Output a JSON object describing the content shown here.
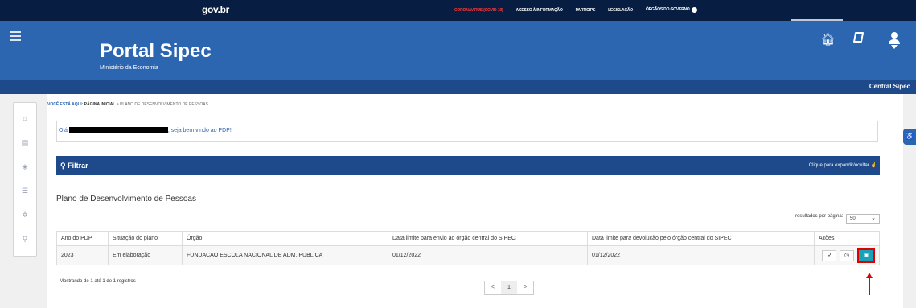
{
  "govbar": {
    "logo": "gov.br",
    "links": [
      "CORONAVÍRUS (COVID-19)",
      "ACESSO À INFORMAÇÃO",
      "PARTICIPE",
      "LEGISLAÇÃO",
      "ÓRGÃOS DO GOVERNO"
    ]
  },
  "header": {
    "title": "Portal Sipec",
    "subtitle": "Ministério da Economia",
    "subbar": "Central Sipec"
  },
  "breadcrumb": {
    "label": "VOCÊ ESTÁ AQUI:",
    "home": "PÁGINA INICIAL",
    "sep": ">",
    "current": "PLANO DE DESENVOLVIMENTO DE PESSOAS"
  },
  "welcome": {
    "prefix": "Olá",
    "suffix": ", seja bem vindo ao PDP!"
  },
  "filter": {
    "title": "Filtrar",
    "toggle": "Clique para expandir/ocultar"
  },
  "section_title": "Plano de Desenvolvimento de Pessoas",
  "per_page": {
    "label": "resultados por página:",
    "value": "50"
  },
  "table": {
    "headers": [
      "Ano do PDP",
      "Situação do plano",
      "Órgão",
      "Data limite para envio ao órgão central do SIPEC",
      "Data limite para devolução pelo órgão central do SIPEC",
      "Ações"
    ],
    "rows": [
      [
        "2023",
        "Em elaboração",
        "FUNDACAO ESCOLA NACIONAL DE ADM. PUBLICA",
        "01/12/2022",
        "01/12/2022"
      ]
    ]
  },
  "records": "Mostrando de 1 até 1 de 1 registros",
  "pager": {
    "prev": "<",
    "page": "1",
    "next": ">"
  }
}
